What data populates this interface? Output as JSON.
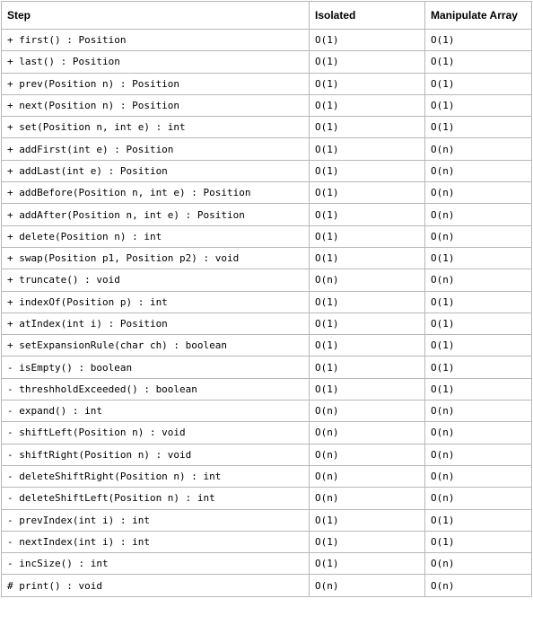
{
  "table": {
    "headers": [
      "Step",
      "Isolated",
      "Manipulate Array"
    ],
    "rows": [
      [
        "+ first() : Position",
        "O(1)",
        "O(1)"
      ],
      [
        "+ last() : Position",
        "O(1)",
        "O(1)"
      ],
      [
        "+ prev(Position n) : Position",
        "O(1)",
        "O(1)"
      ],
      [
        "+ next(Position n) : Position",
        "O(1)",
        "O(1)"
      ],
      [
        "+ set(Position n, int e) : int",
        "O(1)",
        "O(1)"
      ],
      [
        "+ addFirst(int e) : Position",
        "O(1)",
        "O(n)"
      ],
      [
        "+ addLast(int e) : Position",
        "O(1)",
        "O(n)"
      ],
      [
        "+ addBefore(Position n, int e) : Position",
        "O(1)",
        "O(n)"
      ],
      [
        "+ addAfter(Position n, int e) : Position",
        "O(1)",
        "O(n)"
      ],
      [
        "+ delete(Position n) : int",
        "O(1)",
        "O(n)"
      ],
      [
        "+ swap(Position p1, Position p2) : void",
        "O(1)",
        "O(1)"
      ],
      [
        "+ truncate() : void",
        "O(n)",
        "O(n)"
      ],
      [
        "+ indexOf(Position p) : int",
        "O(1)",
        "O(1)"
      ],
      [
        "+ atIndex(int i) : Position",
        "O(1)",
        "O(1)"
      ],
      [
        "+ setExpansionRule(char ch) : boolean",
        "O(1)",
        "O(1)"
      ],
      [
        "- isEmpty() : boolean",
        "O(1)",
        "O(1)"
      ],
      [
        "- threshholdExceeded() : boolean",
        "O(1)",
        "O(1)"
      ],
      [
        "- expand() : int",
        "O(n)",
        "O(n)"
      ],
      [
        "- shiftLeft(Position n) : void",
        "O(n)",
        "O(n)"
      ],
      [
        "- shiftRight(Position n) : void",
        "O(n)",
        "O(n)"
      ],
      [
        "- deleteShiftRight(Position n) : int",
        "O(n)",
        "O(n)"
      ],
      [
        "- deleteShiftLeft(Position n) : int",
        "O(n)",
        "O(n)"
      ],
      [
        "- prevIndex(int i) : int",
        "O(1)",
        "O(1)"
      ],
      [
        "- nextIndex(int i) : int",
        "O(1)",
        "O(1)"
      ],
      [
        "- incSize() : int",
        "O(1)",
        "O(n)"
      ],
      [
        "# print() : void",
        "O(n)",
        "O(n)"
      ]
    ]
  }
}
